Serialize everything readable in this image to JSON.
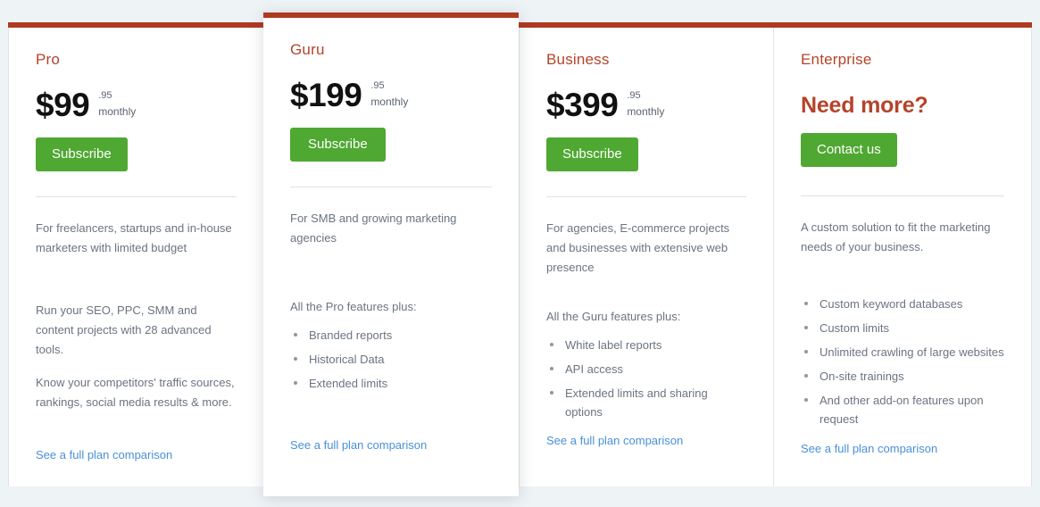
{
  "theme": {
    "page_background": "#eef3f6",
    "accent_red": "#ae3a22",
    "plan_name_color": "#b5432a",
    "cta_green": "#4fa832",
    "link_blue": "#4a90d9",
    "body_text": "#6b7480",
    "divider": "#e6dfe0"
  },
  "plans": [
    {
      "name": "Pro",
      "price_main": "$99",
      "price_cents": ".95",
      "price_period": "monthly",
      "cta_label": "Subscribe",
      "description": "For freelancers, startups and in-house marketers with limited budget",
      "paragraphs": [
        "Run your SEO, PPC, SMM and content projects with 28 advanced tools.",
        "Know your competitors' traffic sources, rankings, social media results & more."
      ],
      "features_intro": "",
      "features": [],
      "link_label": "See a full plan comparison"
    },
    {
      "name": "Guru",
      "price_main": "$199",
      "price_cents": ".95",
      "price_period": "monthly",
      "cta_label": "Subscribe",
      "description": "For SMB and growing marketing agencies",
      "paragraphs": [],
      "features_intro": "All the Pro features plus:",
      "features": [
        "Branded reports",
        "Historical Data",
        "Extended limits"
      ],
      "link_label": "See a full plan comparison"
    },
    {
      "name": "Business",
      "price_main": "$399",
      "price_cents": ".95",
      "price_period": "monthly",
      "cta_label": "Subscribe",
      "description": "For agencies, E-commerce projects and businesses with extensive web presence",
      "paragraphs": [],
      "features_intro": "All the Guru features plus:",
      "features": [
        "White label reports",
        "API access",
        "Extended limits and sharing options"
      ],
      "link_label": "See a full plan comparison"
    },
    {
      "name": "Enterprise",
      "headline": "Need more?",
      "cta_label": "Contact us",
      "description": "A custom solution to fit the marketing needs of your business.",
      "paragraphs": [],
      "features_intro": "",
      "features": [
        "Custom keyword databases",
        "Custom limits",
        "Unlimited crawling of large websites",
        "On-site trainings",
        "And other add-on features upon request"
      ],
      "link_label": "See a full plan comparison"
    }
  ]
}
